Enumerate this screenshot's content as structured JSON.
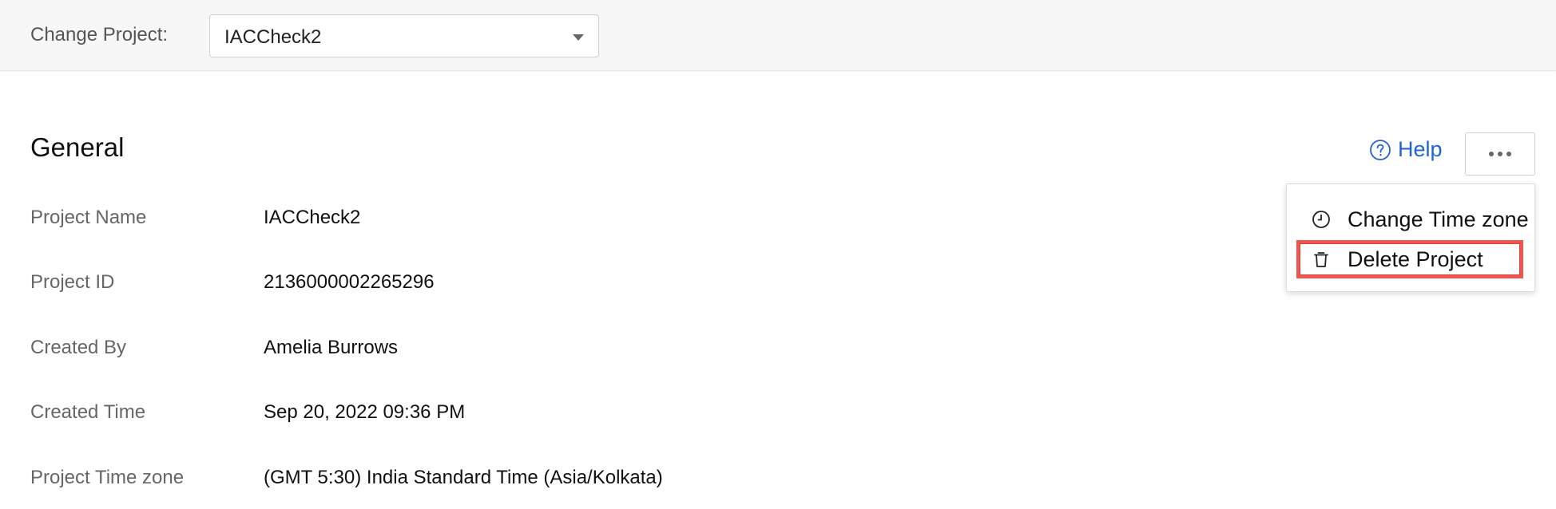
{
  "header": {
    "change_project_label": "Change Project:",
    "selected_project": "IACCheck2"
  },
  "section": {
    "title": "General"
  },
  "toolbar": {
    "help_label": "Help",
    "help_icon": "help-circle-icon",
    "more_icon": "more-horizontal-icon"
  },
  "menu": {
    "items": [
      {
        "label": "Change Time zone",
        "icon": "clock-icon"
      },
      {
        "label": "Delete Project",
        "icon": "trash-icon",
        "highlight_color": "#f0554f"
      }
    ]
  },
  "details": [
    {
      "label": "Project Name",
      "value": "IACCheck2"
    },
    {
      "label": "Project ID",
      "value": "2136000002265296"
    },
    {
      "label": "Created By",
      "value": "Amelia Burrows"
    },
    {
      "label": "Created Time",
      "value": "Sep 20, 2022 09:36 PM"
    },
    {
      "label": "Project Time zone",
      "value": "(GMT 5:30) India Standard Time (Asia/Kolkata)"
    }
  ],
  "colors": {
    "link": "#1f63d6",
    "topbar_bg": "#f7f7f7",
    "highlight": "#f0554f"
  }
}
